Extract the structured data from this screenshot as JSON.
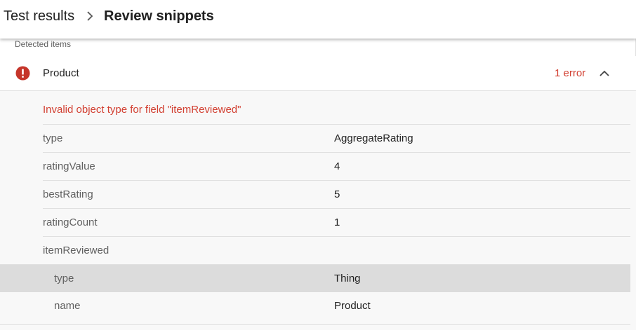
{
  "breadcrumb": {
    "root": "Test results",
    "current": "Review snippets"
  },
  "section_label": "Detected items",
  "item": {
    "title": "Product",
    "error_count": "1 error",
    "error_message": "Invalid object type for field \"itemReviewed\""
  },
  "properties": [
    {
      "key": "type",
      "value": "AggregateRating"
    },
    {
      "key": "ratingValue",
      "value": "4"
    },
    {
      "key": "bestRating",
      "value": "5"
    },
    {
      "key": "ratingCount",
      "value": "1"
    },
    {
      "key": "itemReviewed",
      "value": ""
    }
  ],
  "nested_properties": [
    {
      "key": "type",
      "value": "Thing"
    },
    {
      "key": "name",
      "value": "Product"
    }
  ],
  "colors": {
    "error": "#d23f31",
    "highlight_row": "#dcdcdc",
    "details_bg": "#f8f8f8"
  }
}
